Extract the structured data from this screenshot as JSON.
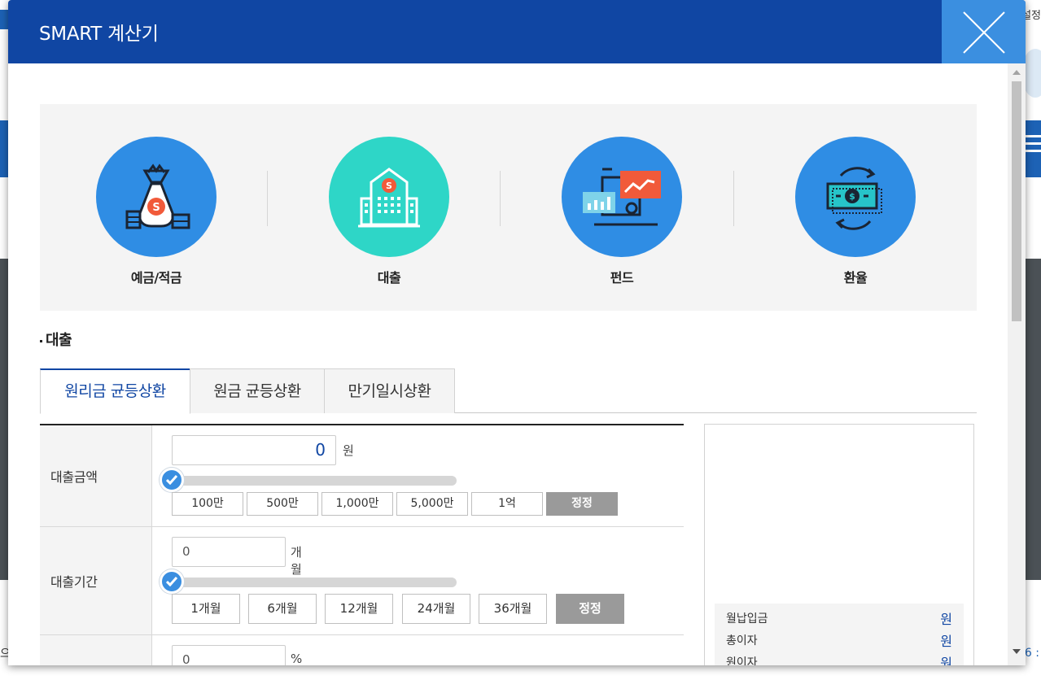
{
  "modal": {
    "title": "SMART 계산기"
  },
  "background": {
    "right_top_text": "설정",
    "right_bottom_text": "6 :",
    "left_bottom_text": "으"
  },
  "categories": [
    {
      "label": "예금/적금",
      "icon": "money-bag-icon",
      "color": "#2f8de4"
    },
    {
      "label": "대출",
      "icon": "bank-building-icon",
      "color": "#2ed6c7"
    },
    {
      "label": "펀드",
      "icon": "fund-chart-icon",
      "color": "#2f8de4"
    },
    {
      "label": "환율",
      "icon": "currency-exchange-icon",
      "color": "#2f8de4"
    }
  ],
  "section": {
    "title": "대출"
  },
  "tabs": [
    {
      "label": "원리금 균등상환",
      "active": true
    },
    {
      "label": "원금 균등상환",
      "active": false
    },
    {
      "label": "만기일시상환",
      "active": false
    }
  ],
  "form": {
    "amount": {
      "label": "대출금액",
      "value": "0",
      "unit": "원",
      "slider_fraction": 0,
      "quick": [
        "100만",
        "500만",
        "1,000만",
        "5,000만",
        "1억"
      ],
      "reset": "정정"
    },
    "period": {
      "label": "대출기간",
      "value": "0",
      "unit": "개월",
      "slider_fraction": 0,
      "quick": [
        "1개월",
        "6개월",
        "12개월",
        "24개월",
        "36개월"
      ],
      "reset": "정정"
    },
    "rate": {
      "value": "0",
      "unit": "%"
    }
  },
  "result": {
    "items": [
      {
        "label": "월납입금",
        "unit": "원"
      },
      {
        "label": "총이자",
        "unit": "원"
      },
      {
        "label": "원이자",
        "unit": "원"
      }
    ]
  },
  "colors": {
    "header": "#1046a3",
    "close": "#3b8fe0",
    "accent": "#1046a3",
    "teal": "#2ed6c7",
    "blue_circle": "#2f8de4"
  }
}
